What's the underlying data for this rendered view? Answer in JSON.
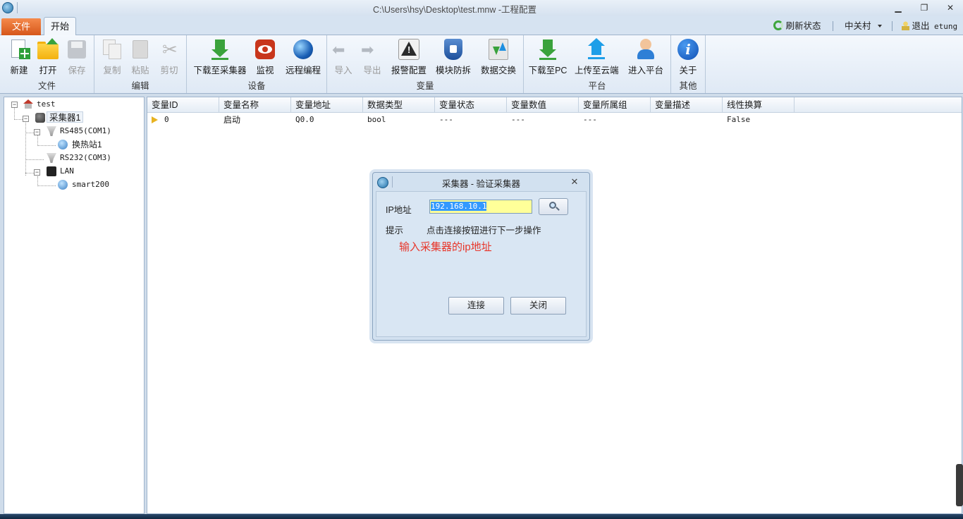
{
  "window": {
    "title": "C:\\Users\\hsy\\Desktop\\test.mnw -工程配置",
    "controls": {
      "minimize": "▁",
      "restore": "❐",
      "close": "✕"
    }
  },
  "tabs": {
    "file": "文件",
    "start": "开始"
  },
  "ribbon_right": {
    "refresh": "刷新状态",
    "location": "中关村",
    "logout": "退出",
    "user": "etung"
  },
  "ribbon": {
    "groups": {
      "file": "文件",
      "edit": "编辑",
      "device": "设备",
      "variable": "变量",
      "platform": "平台",
      "other": "其他"
    },
    "buttons": {
      "new": "新建",
      "open": "打开",
      "save": "保存",
      "copy": "复制",
      "paste": "粘贴",
      "cut": "剪切",
      "download_collector": "下载至采集器",
      "monitor": "监视",
      "remote_program": "远程编程",
      "import": "导入",
      "export": "导出",
      "alarm_config": "报警配置",
      "module_protect": "模块防拆",
      "data_exchange": "数据交换",
      "download_pc": "下载至PC",
      "upload_cloud": "上传至云端",
      "enter_platform": "进入平台",
      "about": "关于"
    }
  },
  "tree": {
    "root": "test",
    "collector": "采集器1",
    "rs485": "RS485(COM1)",
    "station": "换热站1",
    "rs232": "RS232(COM3)",
    "lan": "LAN",
    "smart": "smart200"
  },
  "table": {
    "columns": [
      "变量ID",
      "变量名称",
      "变量地址",
      "数据类型",
      "变量状态",
      "变量数值",
      "变量所属组",
      "变量描述",
      "线性换算"
    ],
    "rows": [
      [
        "0",
        "启动",
        "Q0.0",
        "bool",
        "---",
        "---",
        "---",
        "",
        "False"
      ]
    ]
  },
  "dialog": {
    "title": "采集器 - 验证采集器",
    "ip_label": "IP地址",
    "ip_value": "192.168.10.1",
    "hint_label": "提示",
    "hint_text": "点击连接按钮进行下一步操作",
    "red_tip": "输入采集器的ip地址",
    "connect": "连接",
    "close": "关闭"
  },
  "colors": {
    "file_tab": "#e36a2b",
    "accent_red": "#e8362a",
    "input_bg": "#ffff99"
  }
}
